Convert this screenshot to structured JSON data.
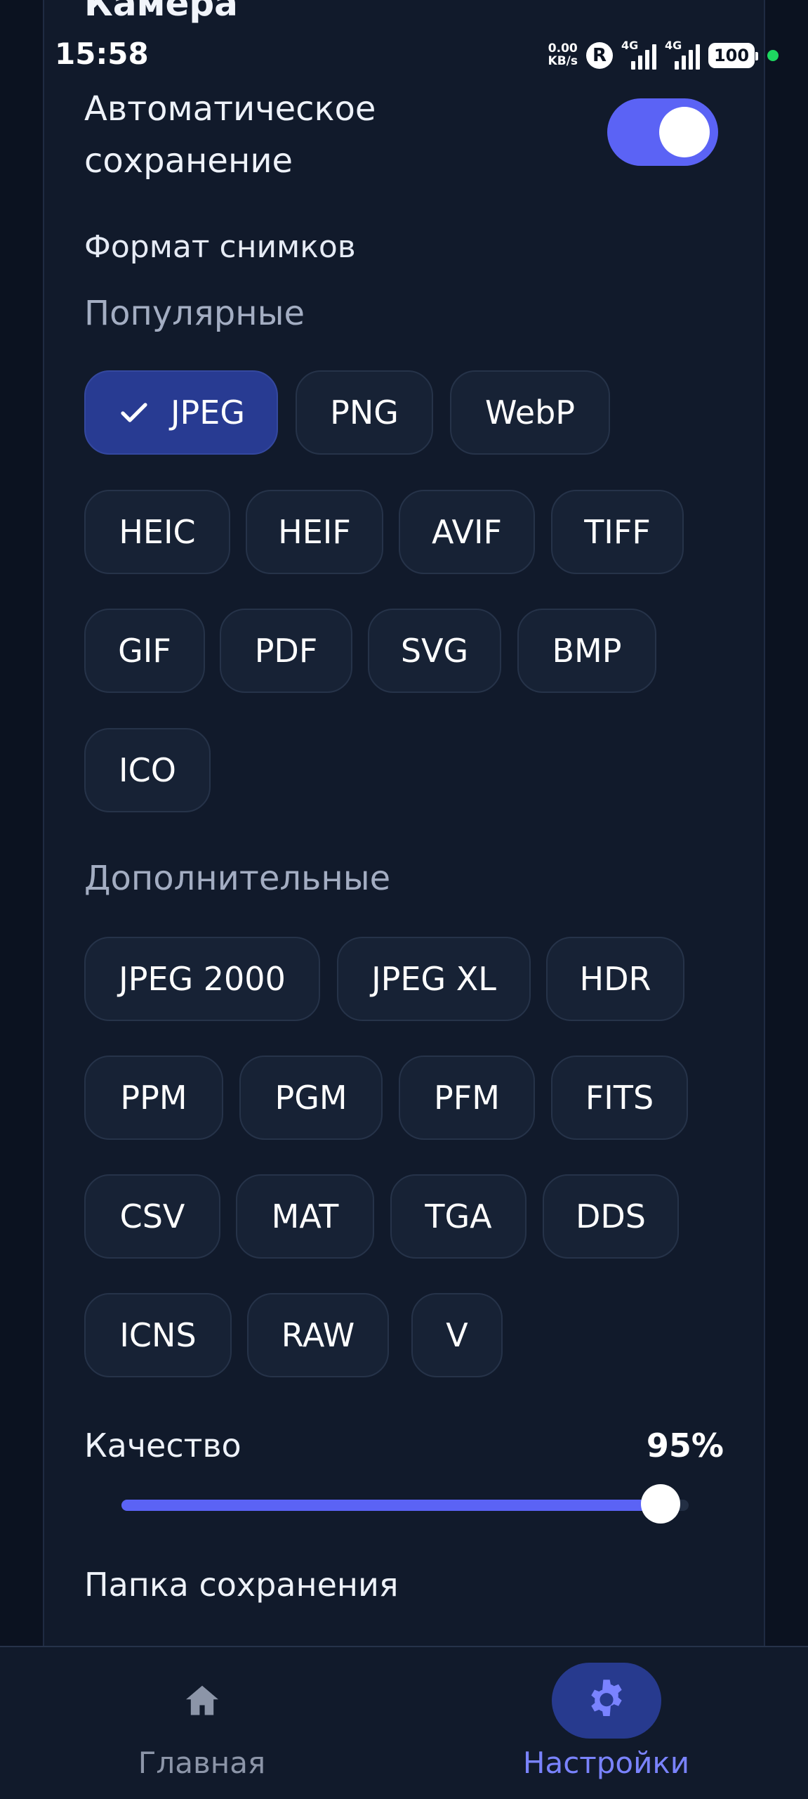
{
  "status_bar": {
    "time": "15:58",
    "net_speed_value": "0.00",
    "net_speed_unit": "KB/s",
    "roaming": "R",
    "sim1_label": "4G",
    "sim2_label": "4G",
    "battery": "100"
  },
  "section": {
    "title": "Камера"
  },
  "auto_save": {
    "label": "Автоматическое сохранение",
    "enabled": true
  },
  "format": {
    "label": "Формат снимков",
    "popular_title": "Популярные",
    "popular": [
      {
        "label": "JPEG",
        "selected": true
      },
      {
        "label": "PNG",
        "selected": false
      },
      {
        "label": "WebP",
        "selected": false
      },
      {
        "label": "HEIC",
        "selected": false
      },
      {
        "label": "HEIF",
        "selected": false
      },
      {
        "label": "AVIF",
        "selected": false
      },
      {
        "label": "TIFF",
        "selected": false
      },
      {
        "label": "GIF",
        "selected": false
      },
      {
        "label": "PDF",
        "selected": false
      },
      {
        "label": "SVG",
        "selected": false
      },
      {
        "label": "BMP",
        "selected": false
      },
      {
        "label": "ICO",
        "selected": false
      }
    ],
    "extra_title": "Дополнительные",
    "extra": [
      {
        "label": "JPEG 2000",
        "selected": false
      },
      {
        "label": "JPEG XL",
        "selected": false
      },
      {
        "label": "HDR",
        "selected": false
      },
      {
        "label": "PPM",
        "selected": false
      },
      {
        "label": "PGM",
        "selected": false
      },
      {
        "label": "PFM",
        "selected": false
      },
      {
        "label": "FITS",
        "selected": false
      },
      {
        "label": "CSV",
        "selected": false
      },
      {
        "label": "MAT",
        "selected": false
      },
      {
        "label": "TGA",
        "selected": false
      },
      {
        "label": "DDS",
        "selected": false
      },
      {
        "label": "ICNS",
        "selected": false
      },
      {
        "label": "RAW",
        "selected": false
      },
      {
        "label": "V",
        "selected": false
      }
    ]
  },
  "quality": {
    "label": "Качество",
    "value_text": "95%",
    "value_fraction": 0.95
  },
  "save_folder": {
    "label": "Папка сохранения"
  },
  "bottom_nav": [
    {
      "label": "Главная",
      "icon": "home-icon",
      "active": false
    },
    {
      "label": "Настройки",
      "icon": "gear-icon",
      "active": true
    }
  ],
  "colors": {
    "accent": "#5b63f5",
    "background": "#0b1220",
    "card": "#111a2b",
    "chip": "#172235",
    "chip_selected": "#283b92",
    "nav_active_text": "#7a83ff",
    "status_dot": "#1ed760"
  }
}
